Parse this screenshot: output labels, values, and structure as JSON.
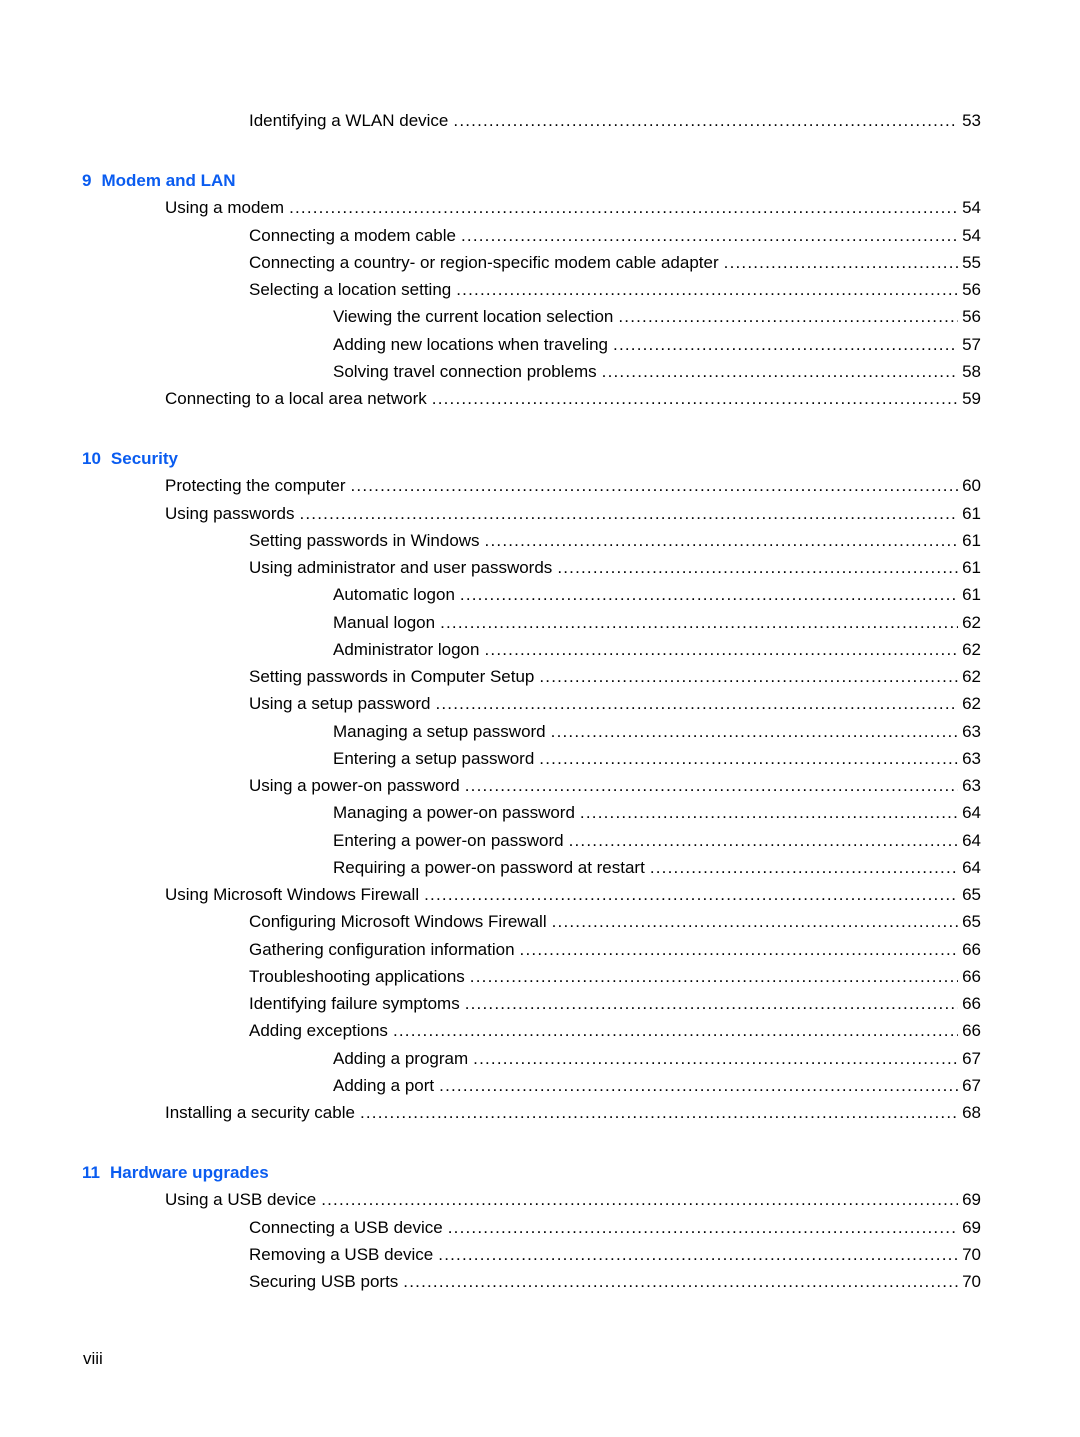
{
  "accent_color": "#0a5cf0",
  "entries": [
    {
      "type": "entry",
      "level": 2,
      "title": "Identifying a WLAN device",
      "page": "53"
    },
    {
      "type": "chapter",
      "number": "9",
      "title": "Modem and LAN"
    },
    {
      "type": "entry",
      "level": 1,
      "title": "Using a modem",
      "page": "54"
    },
    {
      "type": "entry",
      "level": 2,
      "title": "Connecting a modem cable",
      "page": "54"
    },
    {
      "type": "entry",
      "level": 2,
      "title": "Connecting a country- or region-specific modem cable adapter",
      "page": "55"
    },
    {
      "type": "entry",
      "level": 2,
      "title": "Selecting a location setting",
      "page": "56"
    },
    {
      "type": "entry",
      "level": 3,
      "title": "Viewing the current location selection",
      "page": "56"
    },
    {
      "type": "entry",
      "level": 3,
      "title": "Adding new locations when traveling",
      "page": "57"
    },
    {
      "type": "entry",
      "level": 3,
      "title": "Solving travel connection problems",
      "page": "58"
    },
    {
      "type": "entry",
      "level": 1,
      "title": "Connecting to a local area network",
      "page": "59"
    },
    {
      "type": "chapter",
      "number": "10",
      "title": "Security"
    },
    {
      "type": "entry",
      "level": 1,
      "title": "Protecting the computer",
      "page": "60"
    },
    {
      "type": "entry",
      "level": 1,
      "title": "Using passwords",
      "page": "61"
    },
    {
      "type": "entry",
      "level": 2,
      "title": "Setting passwords in Windows",
      "page": "61"
    },
    {
      "type": "entry",
      "level": 2,
      "title": "Using administrator and user passwords",
      "page": "61"
    },
    {
      "type": "entry",
      "level": 3,
      "title": "Automatic logon",
      "page": "61"
    },
    {
      "type": "entry",
      "level": 3,
      "title": "Manual logon",
      "page": "62"
    },
    {
      "type": "entry",
      "level": 3,
      "title": "Administrator logon",
      "page": "62"
    },
    {
      "type": "entry",
      "level": 2,
      "title": "Setting passwords in Computer Setup",
      "page": "62"
    },
    {
      "type": "entry",
      "level": 2,
      "title": "Using a setup password",
      "page": "62"
    },
    {
      "type": "entry",
      "level": 3,
      "title": "Managing a setup password",
      "page": "63"
    },
    {
      "type": "entry",
      "level": 3,
      "title": "Entering a setup password",
      "page": "63"
    },
    {
      "type": "entry",
      "level": 2,
      "title": "Using a power-on password",
      "page": "63"
    },
    {
      "type": "entry",
      "level": 3,
      "title": "Managing a power-on password",
      "page": "64"
    },
    {
      "type": "entry",
      "level": 3,
      "title": "Entering a power-on password",
      "page": "64"
    },
    {
      "type": "entry",
      "level": 3,
      "title": "Requiring a power-on password at restart",
      "page": "64"
    },
    {
      "type": "entry",
      "level": 1,
      "title": "Using Microsoft Windows Firewall",
      "page": "65"
    },
    {
      "type": "entry",
      "level": 2,
      "title": "Configuring Microsoft Windows Firewall",
      "page": "65"
    },
    {
      "type": "entry",
      "level": 2,
      "title": "Gathering configuration information",
      "page": "66"
    },
    {
      "type": "entry",
      "level": 2,
      "title": "Troubleshooting applications",
      "page": "66"
    },
    {
      "type": "entry",
      "level": 2,
      "title": "Identifying failure symptoms",
      "page": "66"
    },
    {
      "type": "entry",
      "level": 2,
      "title": "Adding exceptions",
      "page": "66"
    },
    {
      "type": "entry",
      "level": 3,
      "title": "Adding a program",
      "page": "67"
    },
    {
      "type": "entry",
      "level": 3,
      "title": "Adding a port",
      "page": "67"
    },
    {
      "type": "entry",
      "level": 1,
      "title": "Installing a security cable",
      "page": "68"
    },
    {
      "type": "chapter",
      "number": "11",
      "title": "Hardware upgrades"
    },
    {
      "type": "entry",
      "level": 1,
      "title": "Using a USB device",
      "page": "69"
    },
    {
      "type": "entry",
      "level": 2,
      "title": "Connecting a USB device",
      "page": "69"
    },
    {
      "type": "entry",
      "level": 2,
      "title": "Removing a USB device",
      "page": "70"
    },
    {
      "type": "entry",
      "level": 2,
      "title": "Securing USB ports",
      "page": "70"
    }
  ],
  "footer": {
    "page_number": "viii"
  }
}
